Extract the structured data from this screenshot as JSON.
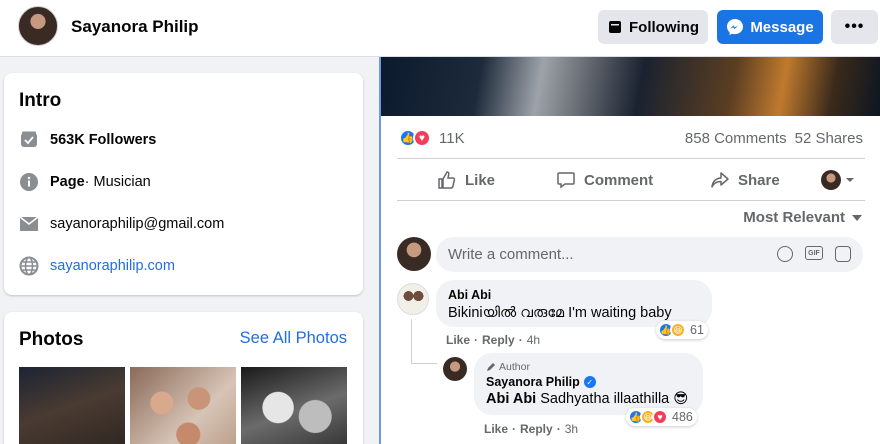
{
  "header": {
    "profile_name": "Sayanora Philip",
    "following_label": "Following",
    "message_label": "Message",
    "more_label": "•••"
  },
  "intro": {
    "title": "Intro",
    "followers": "563K Followers",
    "page_label": "Page",
    "page_category": " · Musician",
    "email": "sayanoraphilip@gmail.com",
    "website": "sayanoraphilip.com"
  },
  "photos": {
    "title": "Photos",
    "see_all": "See All Photos"
  },
  "post": {
    "reactions_count": "11K",
    "comments_count": "858 Comments",
    "shares_count": "52 Shares",
    "actions": {
      "like": "Like",
      "comment": "Comment",
      "share": "Share"
    },
    "sort_label": "Most Relevant",
    "comment_placeholder": "Write a comment..."
  },
  "comments": [
    {
      "author": "Abi Abi",
      "text": "Bikiniയിൽ വരുമേ I'm waiting baby",
      "like": "Like",
      "reply": "Reply",
      "time": "4h",
      "reaction_count": "61"
    },
    {
      "badge": "Author",
      "author": "Sayanora Philip",
      "mention": "Abi Abi",
      "text": " Sadhyatha illaathilla 😎",
      "like": "Like",
      "reply": "Reply",
      "time": "3h",
      "reaction_count": "486"
    }
  ],
  "colors": {
    "brand_blue": "#1b74e4",
    "link_blue": "#216fdb",
    "like_blue": "#1877f2",
    "love_red": "#f33e58",
    "haha_yellow": "#f7b125"
  }
}
